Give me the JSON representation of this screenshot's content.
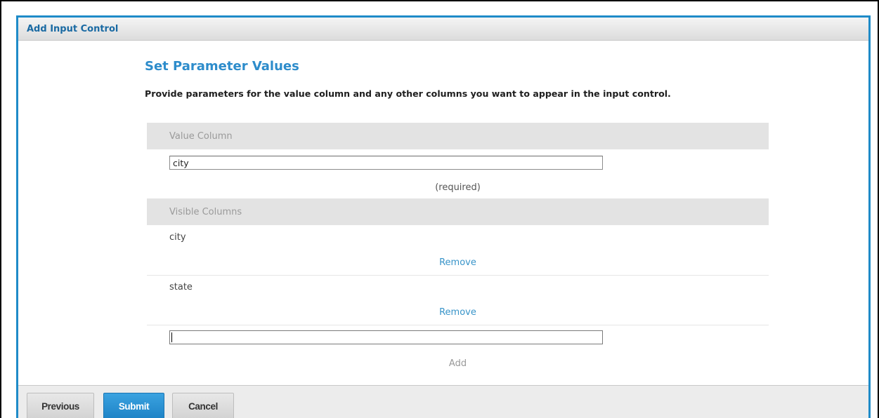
{
  "dialog": {
    "title": "Add Input Control"
  },
  "section": {
    "title": "Set Parameter Values",
    "instructions": "Provide parameters for the value column and any other columns you want to appear in the input control."
  },
  "value_column": {
    "header": "Value Column",
    "input_value": "city",
    "hint": "(required)"
  },
  "visible_columns": {
    "header": "Visible Columns",
    "items": [
      {
        "label": "city",
        "remove_label": "Remove"
      },
      {
        "label": "state",
        "remove_label": "Remove"
      }
    ],
    "new_input_value": "",
    "add_label": "Add"
  },
  "footer": {
    "previous_label": "Previous",
    "submit_label": "Submit",
    "cancel_label": "Cancel"
  },
  "colors": {
    "accent": "#1f8bc8",
    "title": "#2d8ccb",
    "link": "#3894c9",
    "primary_button": "#2a92d3"
  }
}
